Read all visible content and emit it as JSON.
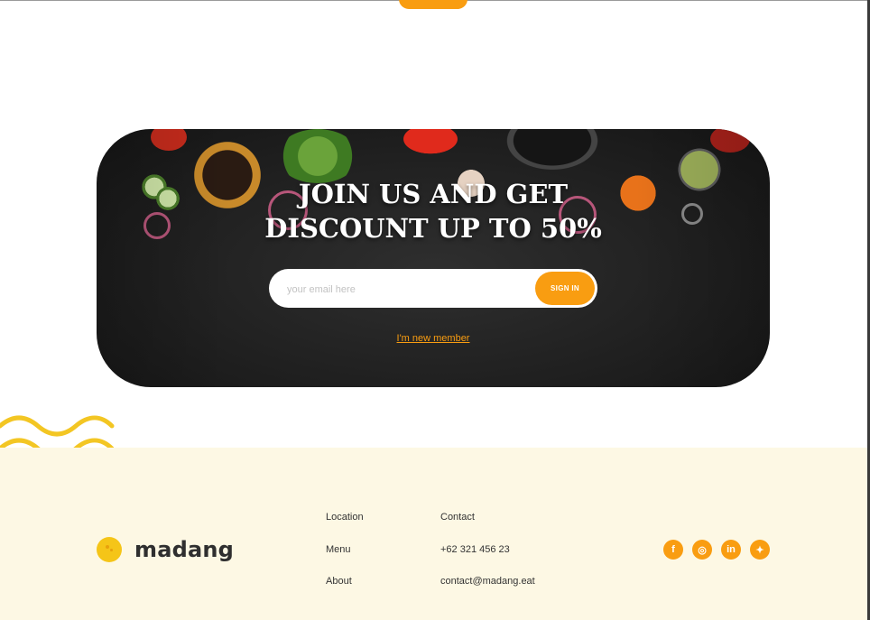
{
  "hero": {
    "title_line1": "JOIN US AND GET",
    "title_line2": "DISCOUNT UP TO 50%",
    "email_placeholder": "your email here",
    "signin_label": "SIGN IN",
    "new_member_link": "I'm new member"
  },
  "footer": {
    "brand": "madang",
    "nav": [
      "Location",
      "Menu",
      "About"
    ],
    "contact": [
      "Contact",
      "+62 321 456 23",
      "contact@madang.eat"
    ],
    "social": [
      {
        "icon": "facebook-icon",
        "glyph": "f"
      },
      {
        "icon": "instagram-icon",
        "glyph": "◎"
      },
      {
        "icon": "linkedin-icon",
        "glyph": "in"
      },
      {
        "icon": "twitter-icon",
        "glyph": "✦"
      }
    ]
  },
  "colors": {
    "accent": "#f99d11",
    "logo_yellow": "#f5c518",
    "footer_bg": "#fdf8e4",
    "waves": "#f3c623"
  }
}
